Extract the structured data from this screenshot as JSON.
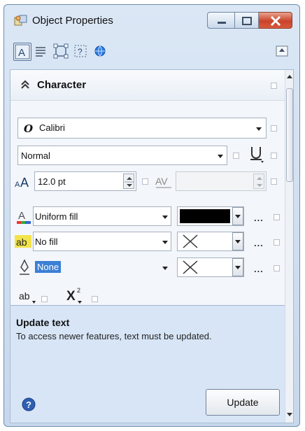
{
  "window": {
    "title": "Object Properties"
  },
  "section": {
    "title": "Character"
  },
  "font": {
    "family": "Calibri",
    "style": "Normal",
    "size": "12.0 pt"
  },
  "fill": {
    "text_fill": "Uniform fill",
    "text_fill_color": "#000000",
    "background_fill": "No fill",
    "outline": "None"
  },
  "info": {
    "title": "Update text",
    "message": "To access newer features, text must be updated.",
    "button_label": "Update"
  },
  "misc": {
    "ellipsis": "..."
  }
}
